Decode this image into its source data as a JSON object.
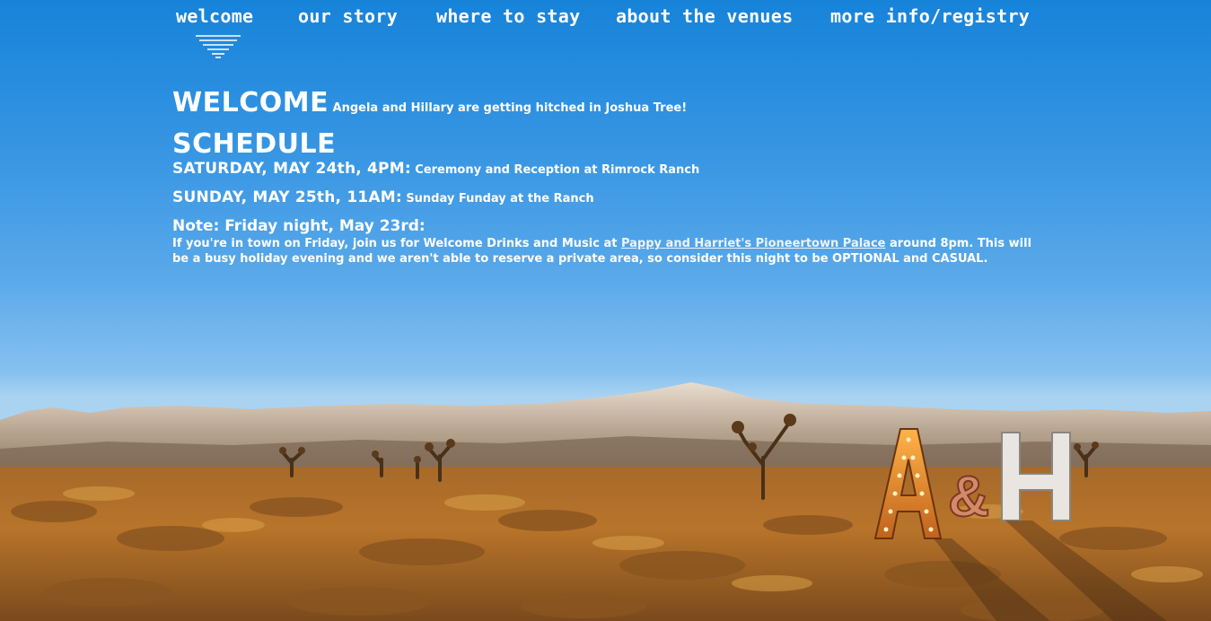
{
  "nav": {
    "items": [
      {
        "label": "welcome"
      },
      {
        "label": "our story"
      },
      {
        "label": "where to stay"
      },
      {
        "label": "about the venues"
      },
      {
        "label": "more info/registry"
      }
    ],
    "active_icon": "striped-triangle-icon"
  },
  "welcome": {
    "heading": "WELCOME",
    "tagline": "Angela and Hillary are getting hitched in Joshua Tree!"
  },
  "schedule": {
    "heading": "SCHEDULE",
    "events": [
      {
        "when": "SATURDAY, MAY 24th, 4PM:",
        "what": "Ceremony and Reception at Rimrock Ranch"
      },
      {
        "when": "SUNDAY, MAY 25th, 11AM:",
        "what": "Sunday Funday at the Ranch"
      }
    ]
  },
  "note": {
    "heading": "Note: Friday night, May 23rd:",
    "text_before": "If you're in town on Friday, join us for Welcome Drinks and Music at ",
    "link": "Pappy and Harriet's Pioneertown Palace",
    "text_after": " around 8pm. This will be a busy holiday evening and we aren't able to reserve a private area, so consider this night to be OPTIONAL and CASUAL."
  },
  "background": {
    "monogram": "A&H",
    "sky_color": "#1683d9",
    "desert_color": "#b8742a"
  }
}
